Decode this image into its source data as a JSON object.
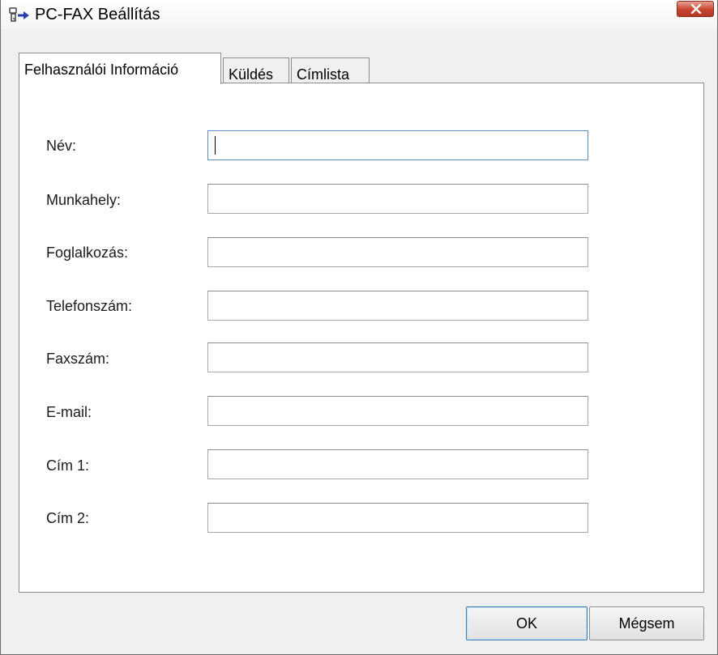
{
  "window": {
    "title": "PC-FAX Beállítás"
  },
  "tabs": [
    {
      "label": "Felhasználói Információ",
      "active": true
    },
    {
      "label": "Küldés",
      "active": false
    },
    {
      "label": "Címlista",
      "active": false
    }
  ],
  "fields": [
    {
      "label": "Név:",
      "value": "",
      "placeholder": ""
    },
    {
      "label": "Munkahely:",
      "value": "",
      "placeholder": ""
    },
    {
      "label": "Foglalkozás:",
      "value": "",
      "placeholder": ""
    },
    {
      "label": "Telefonszám:",
      "value": "",
      "placeholder": ""
    },
    {
      "label": "Faxszám:",
      "value": "",
      "placeholder": ""
    },
    {
      "label": "E-mail:",
      "value": "",
      "placeholder": ""
    },
    {
      "label": "Cím 1:",
      "value": "",
      "placeholder": ""
    },
    {
      "label": "Cím 2:",
      "value": "",
      "placeholder": ""
    }
  ],
  "buttons": {
    "ok_label": "OK",
    "cancel_label": "Mégsem"
  },
  "colors": {
    "close_button": "#c7442f",
    "focus_border": "#5c8fc4",
    "default_button_border": "#3c7fb1"
  },
  "icons": {
    "app": "pc-fax-icon",
    "close": "close-icon"
  }
}
